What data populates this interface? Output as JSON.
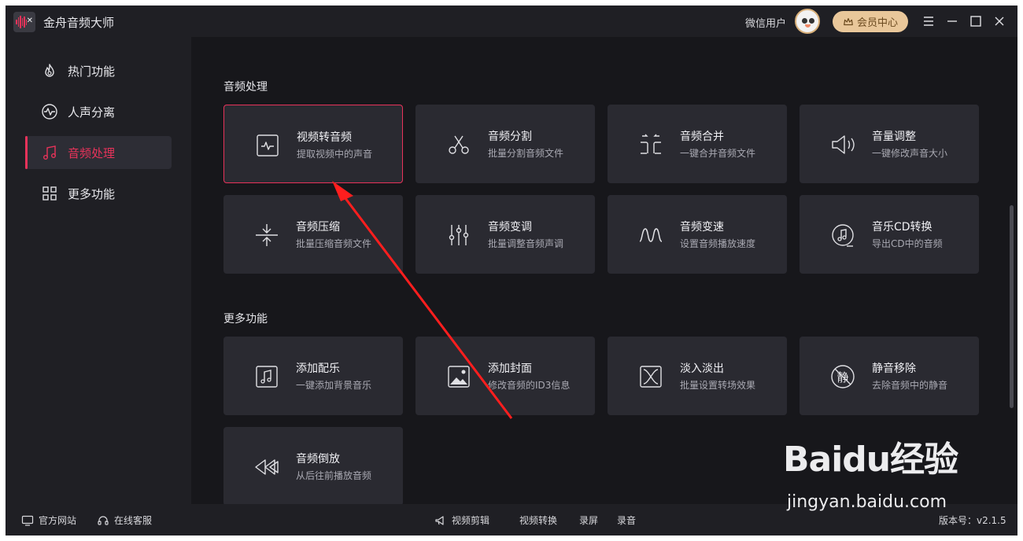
{
  "app": {
    "title": "金舟音频大师"
  },
  "header": {
    "user_name": "微信用户",
    "vip_label": "会员中心"
  },
  "colors": {
    "accent": "#e8335a",
    "vip_bg": "#e9c79a",
    "card_bg": "#2a2a31",
    "main_bg": "#17171b",
    "sidebar_bg": "#1f1f24"
  },
  "sidebar": {
    "items": [
      {
        "label": "热门功能",
        "icon": "flame-icon"
      },
      {
        "label": "人声分离",
        "icon": "waveform-circle-icon"
      },
      {
        "label": "音频处理",
        "icon": "music-note-icon",
        "active": true
      },
      {
        "label": "更多功能",
        "icon": "grid-icon"
      }
    ]
  },
  "sections": {
    "audio": {
      "title": "音频处理",
      "cards": [
        {
          "title": "视频转音频",
          "subtitle": "提取视频中的声音",
          "icon": "video-to-audio-icon",
          "selected": true
        },
        {
          "title": "音频分割",
          "subtitle": "批量分割音频文件",
          "icon": "scissors-icon"
        },
        {
          "title": "音频合并",
          "subtitle": "一键合并音频文件",
          "icon": "merge-icon"
        },
        {
          "title": "音量调整",
          "subtitle": "一键修改声音大小",
          "icon": "speaker-icon"
        },
        {
          "title": "音频压缩",
          "subtitle": "批量压缩音频文件",
          "icon": "compress-icon"
        },
        {
          "title": "音频变调",
          "subtitle": "批量调整音频声调",
          "icon": "sliders-icon"
        },
        {
          "title": "音频变速",
          "subtitle": "设置音频播放速度",
          "icon": "wave-icon"
        },
        {
          "title": "音乐CD转换",
          "subtitle": "导出CD中的音频",
          "icon": "cd-icon"
        }
      ]
    },
    "more": {
      "title": "更多功能",
      "cards": [
        {
          "title": "添加配乐",
          "subtitle": "一键添加背景音乐",
          "icon": "music-box-icon"
        },
        {
          "title": "添加封面",
          "subtitle": "修改音频的ID3信息",
          "icon": "image-icon"
        },
        {
          "title": "淡入淡出",
          "subtitle": "批量设置转场效果",
          "icon": "fade-icon"
        },
        {
          "title": "静音移除",
          "subtitle": "去除音频中的静音",
          "icon": "mute-remove-icon"
        },
        {
          "title": "音频倒放",
          "subtitle": "从后往前播放音频",
          "icon": "rewind-icon"
        }
      ]
    }
  },
  "footer": {
    "website": "官方网站",
    "support": "在线客服",
    "links": [
      "视频剪辑",
      "视频转换",
      "录屏",
      "录音"
    ],
    "version": "版本号：v2.1.5"
  },
  "watermark": {
    "brand": "Baidu经验",
    "url": "jingyan.baidu.com"
  }
}
